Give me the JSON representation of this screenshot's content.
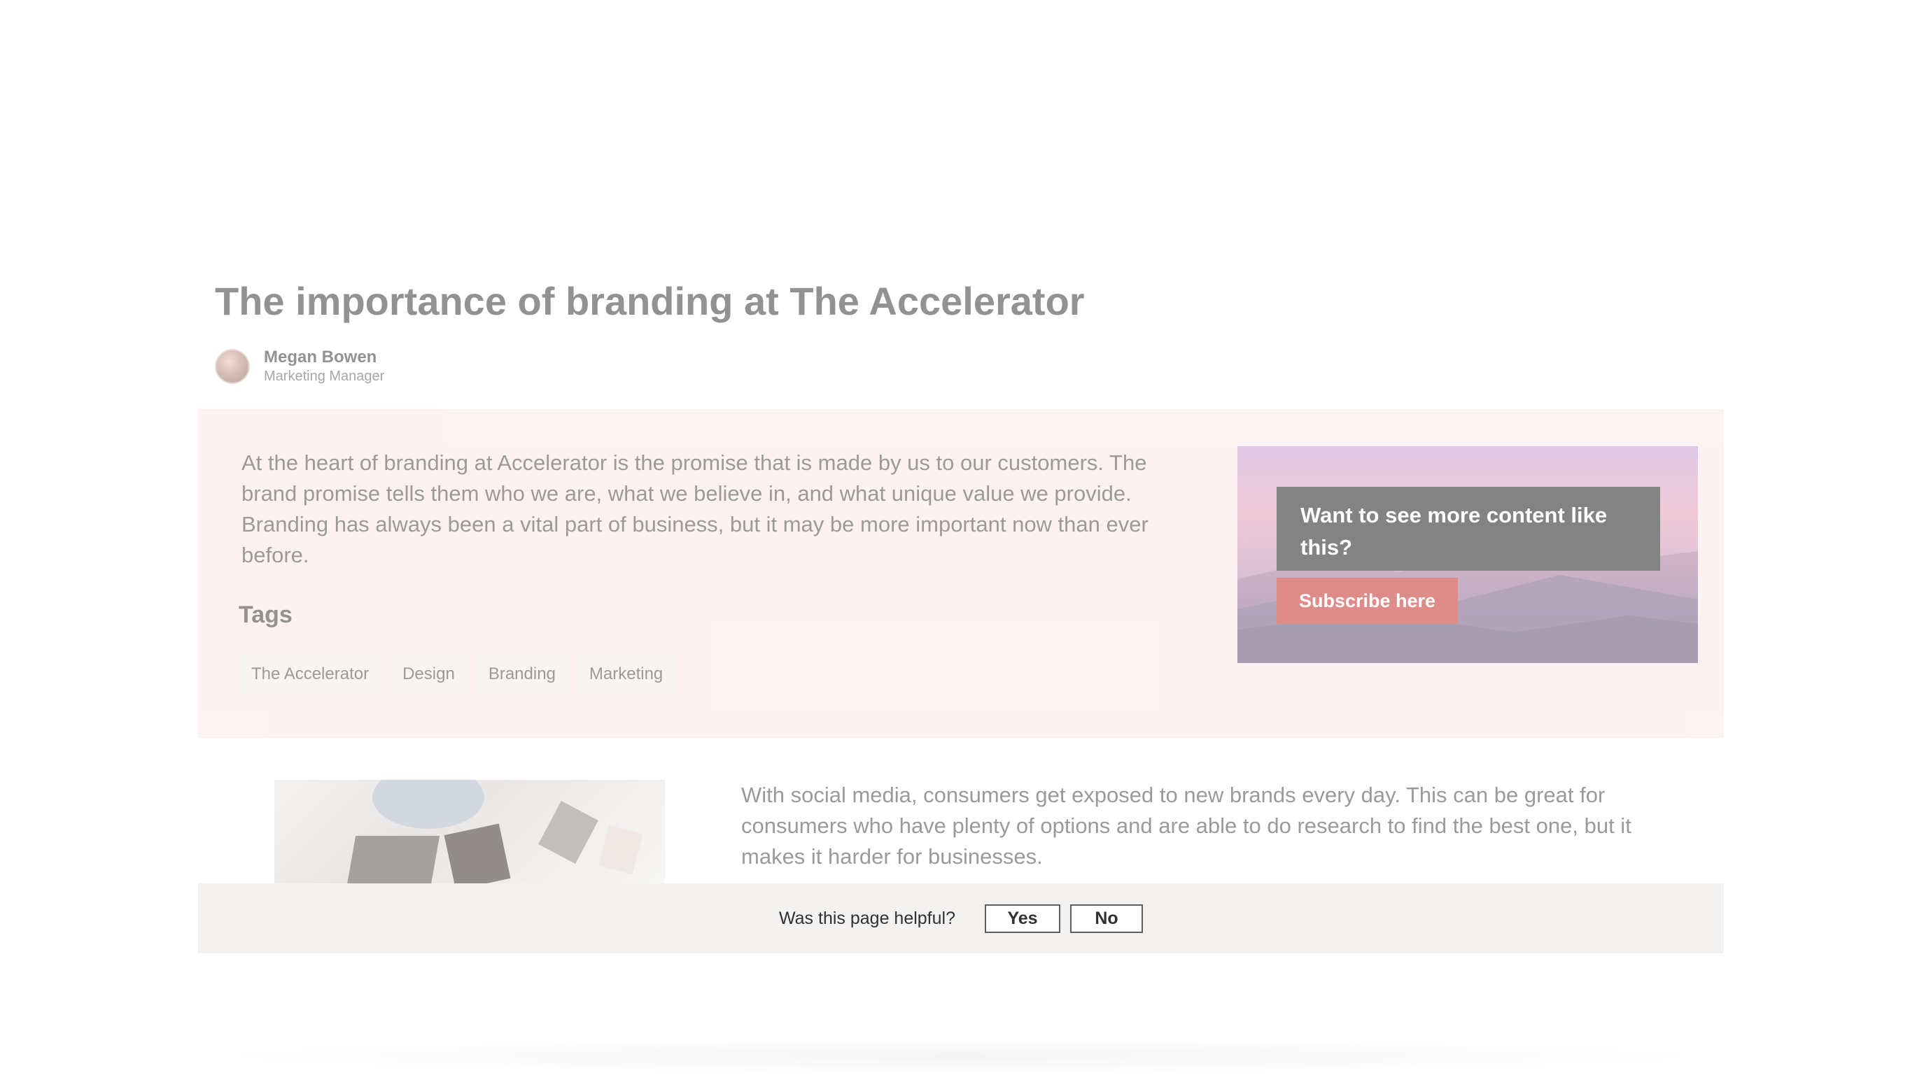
{
  "article": {
    "title": "The importance of branding at The Accelerator",
    "author": {
      "name": "Megan Bowen",
      "role": "Marketing Manager"
    },
    "intro": "At the heart of branding at Accelerator is the promise that is made by us to our customers. The brand promise tells them who we are, what we believe in, and what unique value we provide. Branding has always been a vital part of business, but it may be more important now than ever before.",
    "tags_heading": "Tags",
    "tags": [
      "The Accelerator",
      "Design",
      "Branding",
      "Marketing"
    ],
    "body": "With social media, consumers get exposed to new brands every day. This can be great for consumers who have plenty of options and are able to do research to find the best one, but it makes it harder for businesses."
  },
  "promo": {
    "heading": "Want to see more content like this?",
    "button_label": "Subscribe here",
    "button_color": "#c4302b"
  },
  "feedback": {
    "question": "Was this page helpful?",
    "yes_label": "Yes",
    "no_label": "No"
  }
}
